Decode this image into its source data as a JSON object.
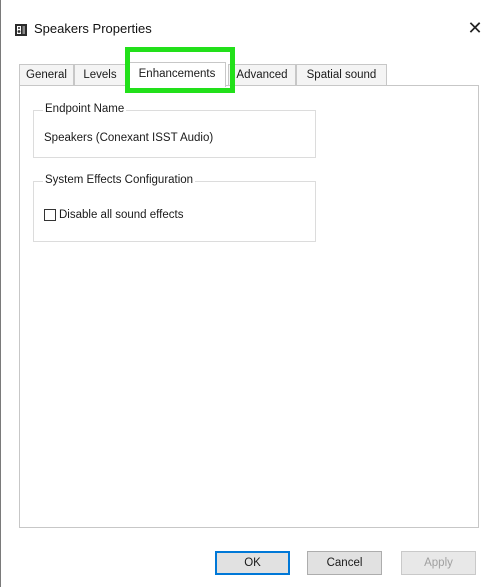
{
  "window": {
    "title": "Speakers Properties",
    "close_glyph": "✕"
  },
  "tabs": [
    {
      "label": "General",
      "active": false
    },
    {
      "label": "Levels",
      "active": false
    },
    {
      "label": "Enhancements",
      "active": true
    },
    {
      "label": "Advanced",
      "active": false
    },
    {
      "label": "Spatial sound",
      "active": false
    }
  ],
  "endpoint": {
    "legend": "Endpoint Name",
    "value": "Speakers (Conexant ISST Audio)"
  },
  "effects": {
    "legend": "System Effects Configuration",
    "checkbox_label": "Disable all sound effects",
    "checked": false
  },
  "buttons": {
    "ok": "OK",
    "cancel": "Cancel",
    "apply": "Apply"
  },
  "colors": {
    "highlight": "#22e01a",
    "default_button_border": "#0078d7"
  },
  "icons": {
    "app": "speaker-icon",
    "close": "close-icon"
  }
}
